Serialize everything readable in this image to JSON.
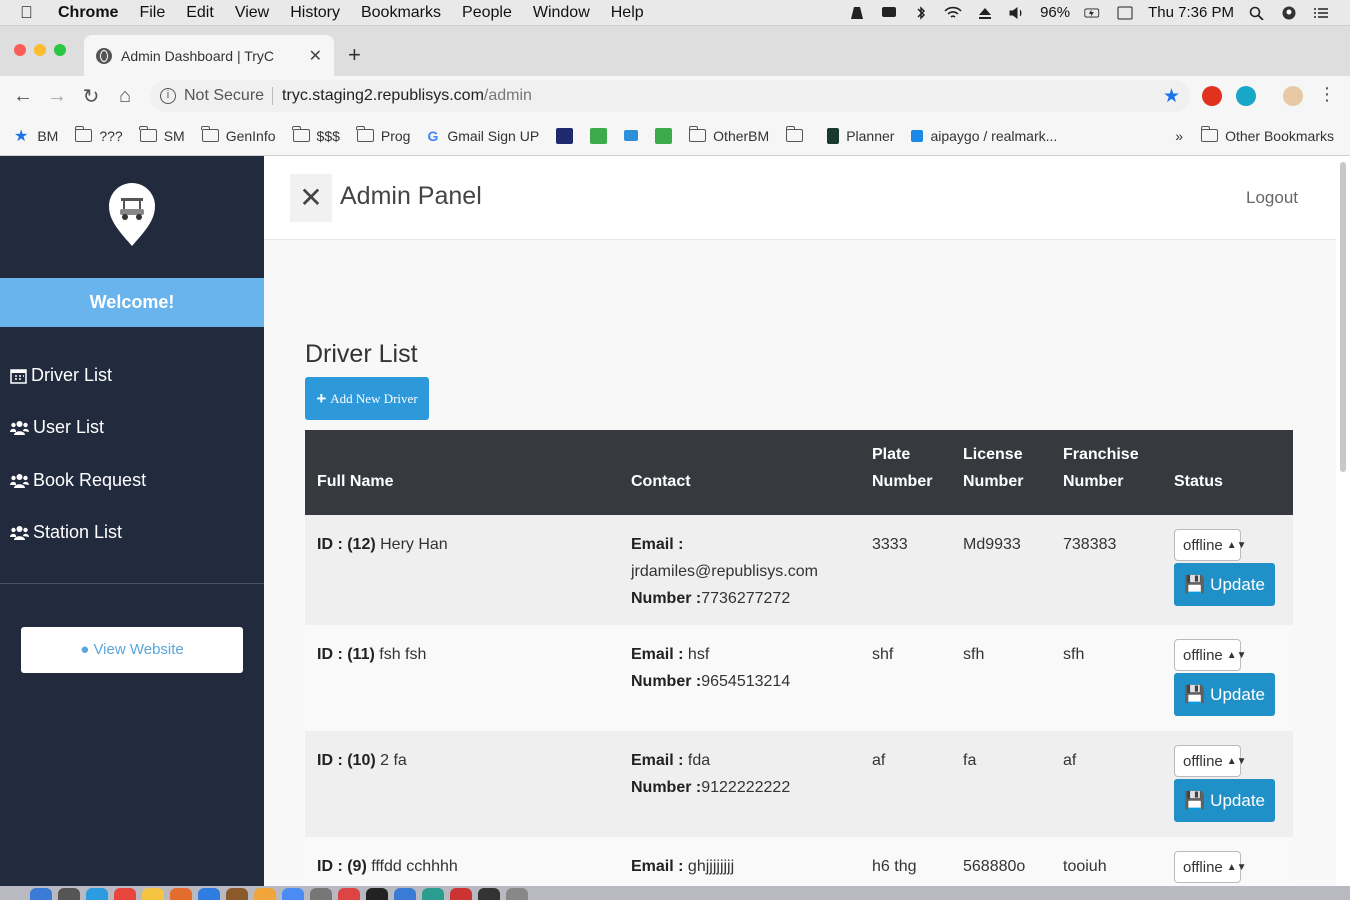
{
  "menubar": {
    "app": "Chrome",
    "items": [
      "File",
      "Edit",
      "View",
      "History",
      "Bookmarks",
      "People",
      "Window",
      "Help"
    ],
    "battery": "96%",
    "clock": "Thu 7:36 PM"
  },
  "browser": {
    "tab_title": "Admin Dashboard | TryC",
    "security": "Not Secure",
    "url_host": "tryc.staging2.republisys.com",
    "url_path": "/admin",
    "bookmarks": [
      "BM",
      "???",
      "SM",
      "GenInfo",
      "$$$",
      "Prog",
      "Gmail Sign UP",
      "OtherBM",
      "Planner",
      "aipaygo / realmark..."
    ],
    "bookmarks_overflow": "»",
    "other_bookmarks": "Other Bookmarks"
  },
  "sidebar": {
    "welcome": "Welcome!",
    "items": [
      {
        "icon": "calendar-icon",
        "label": "Driver List"
      },
      {
        "icon": "users-icon",
        "label": "User List"
      },
      {
        "icon": "users-icon",
        "label": "Book Request"
      },
      {
        "icon": "users-icon",
        "label": "Station List"
      }
    ],
    "view_website": "View Website"
  },
  "header": {
    "close_glyph": "✕",
    "title": "Admin Panel",
    "logout": "Logout"
  },
  "content": {
    "heading": "Driver List",
    "add_button": "Add New Driver",
    "columns": [
      "Full Name",
      "Contact",
      "Plate Number",
      "License Number",
      "Franchise Number",
      "Status"
    ],
    "id_prefix": "ID : ",
    "email_label": "Email :",
    "number_label": "Number :",
    "update_label": "Update",
    "rows": [
      {
        "id": "(12)",
        "name": "Hery Han",
        "email": "jrdamiles@republisys.com",
        "number": "7736277272",
        "plate": "3333",
        "license": "Md9933",
        "franchise": "738383",
        "status": "offline"
      },
      {
        "id": "(11)",
        "name": "fsh fsh",
        "email": "hsf",
        "number": "9654513214",
        "plate": "shf",
        "license": "sfh",
        "franchise": "sfh",
        "status": "offline"
      },
      {
        "id": "(10)",
        "name": "2 fa",
        "email": "fda",
        "number": "9122222222",
        "plate": "af",
        "license": "fa",
        "franchise": "af",
        "status": "offline"
      },
      {
        "id": "(9)",
        "name": "fffdd cchhhh",
        "email": "ghjjjjjjjj",
        "number": "",
        "plate": "h6 thg",
        "license": "568880o",
        "franchise": "tooiuh",
        "status": "offline"
      }
    ]
  },
  "colors": {
    "sidebar_bg": "#222a3e",
    "welcome_bg": "#6ab4ee",
    "primary_button": "#2d98da",
    "update_button": "#1f90c8",
    "table_header": "#363a3f"
  }
}
